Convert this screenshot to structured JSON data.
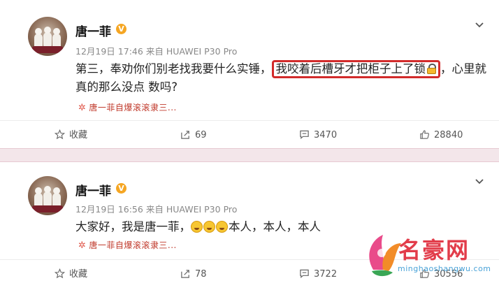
{
  "posts": [
    {
      "author": "唐一菲",
      "verified_badge": "V",
      "date": "12月19日",
      "time": "17:46",
      "from_label": "来自",
      "device": "HUAWEI P30 Pro",
      "text_before": "第三，奉劝你们别老找我要什么实锤，",
      "text_highlight": "我咬着后槽牙才把柜子上了锁",
      "text_after": "，心里就真的那么没点 数吗?",
      "repost_source": "唐一菲自爆滚滚隶三...",
      "actions": {
        "favorite": "收藏",
        "repost": "69",
        "comment": "3470",
        "like": "28840"
      }
    },
    {
      "author": "唐一菲",
      "verified_badge": "V",
      "date": "12月19日",
      "time": "16:56",
      "from_label": "来自",
      "device": "HUAWEI P30 Pro",
      "text_before": "大家好，我是唐一菲，",
      "text_after": "本人，本人，本人",
      "repost_source": "唐一菲自爆滚滚隶三...",
      "actions": {
        "favorite": "收藏",
        "repost": "78",
        "comment": "3722",
        "like": "30556"
      }
    }
  ],
  "watermark": {
    "name": "名豪网",
    "url": "minghaoshangwu.com"
  },
  "colors": {
    "highlight_border": "#d22b2b",
    "divider": "#f3e6ea",
    "badge": "#f5a623",
    "watermark": "#e23c4a"
  }
}
